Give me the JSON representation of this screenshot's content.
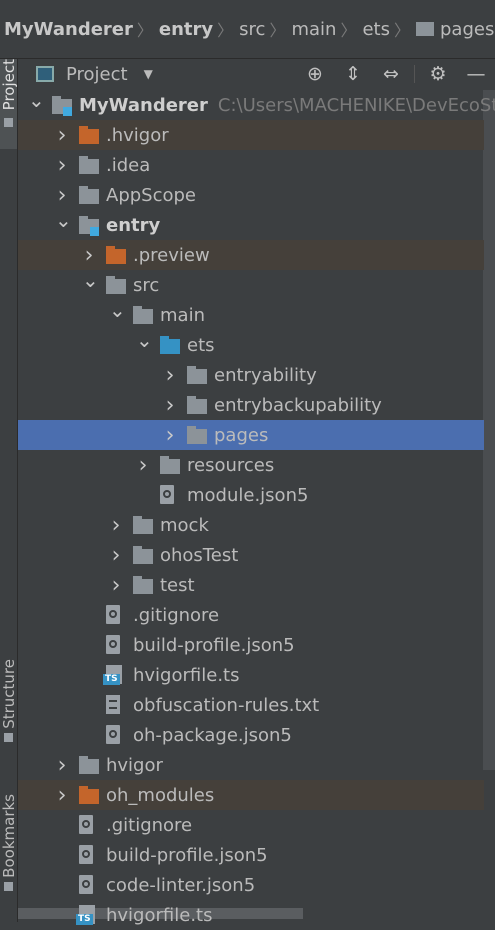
{
  "breadcrumbs": [
    {
      "label": "MyWanderer",
      "bold": true
    },
    {
      "label": "entry",
      "bold": true
    },
    {
      "label": "src"
    },
    {
      "label": "main"
    },
    {
      "label": "ets"
    },
    {
      "label": "pages",
      "folder": true
    }
  ],
  "left_stripe": {
    "project": "Project",
    "structure": "Structure",
    "bookmarks": "Bookmarks"
  },
  "toolwindow": {
    "title": "Project",
    "icons": [
      "locate-icon",
      "expand-all-icon",
      "collapse-all-icon",
      "gear-icon",
      "minimize-icon"
    ]
  },
  "tree": [
    {
      "label": "MyWanderer",
      "path": "C:\\Users\\MACHENIKE\\DevEcoSt",
      "bold": true,
      "level": 0,
      "expanded": true,
      "icon": "module"
    },
    {
      "label": ".hvigor",
      "level": 1,
      "chevron": "right",
      "icon": "folder-orange",
      "excluded": true
    },
    {
      "label": ".idea",
      "level": 1,
      "chevron": "right",
      "icon": "folder"
    },
    {
      "label": "AppScope",
      "level": 1,
      "chevron": "right",
      "icon": "folder"
    },
    {
      "label": "entry",
      "bold": true,
      "level": 1,
      "chevron": "down",
      "icon": "module"
    },
    {
      "label": ".preview",
      "level": 2,
      "chevron": "right",
      "icon": "folder-orange",
      "excluded": true
    },
    {
      "label": "src",
      "level": 2,
      "chevron": "down",
      "icon": "folder"
    },
    {
      "label": "main",
      "level": 3,
      "chevron": "down",
      "icon": "folder"
    },
    {
      "label": "ets",
      "level": 4,
      "chevron": "down",
      "icon": "folder-blue"
    },
    {
      "label": "entryability",
      "level": 5,
      "chevron": "right",
      "icon": "folder"
    },
    {
      "label": "entrybackupability",
      "level": 5,
      "chevron": "right",
      "icon": "folder"
    },
    {
      "label": "pages",
      "level": 5,
      "chevron": "right",
      "icon": "folder",
      "selected": true
    },
    {
      "label": "resources",
      "level": 4,
      "chevron": "right",
      "icon": "folder"
    },
    {
      "label": "module.json5",
      "level": 4,
      "icon": "json"
    },
    {
      "label": "mock",
      "level": 3,
      "chevron": "right",
      "icon": "folder"
    },
    {
      "label": "ohosTest",
      "level": 3,
      "chevron": "right",
      "icon": "folder"
    },
    {
      "label": "test",
      "level": 3,
      "chevron": "right",
      "icon": "folder"
    },
    {
      "label": ".gitignore",
      "level": 2,
      "icon": "json"
    },
    {
      "label": "build-profile.json5",
      "level": 2,
      "icon": "json"
    },
    {
      "label": "hvigorfile.ts",
      "level": 2,
      "icon": "ts"
    },
    {
      "label": "obfuscation-rules.txt",
      "level": 2,
      "icon": "txt"
    },
    {
      "label": "oh-package.json5",
      "level": 2,
      "icon": "json"
    },
    {
      "label": "hvigor",
      "level": 1,
      "chevron": "right",
      "icon": "folder"
    },
    {
      "label": "oh_modules",
      "level": 1,
      "chevron": "right",
      "icon": "folder-orange",
      "excluded": true
    },
    {
      "label": ".gitignore",
      "level": 1,
      "icon": "json"
    },
    {
      "label": "build-profile.json5",
      "level": 1,
      "icon": "json"
    },
    {
      "label": "code-linter.json5",
      "level": 1,
      "icon": "json"
    },
    {
      "label": "hvigorfile.ts",
      "level": 1,
      "icon": "ts"
    }
  ]
}
